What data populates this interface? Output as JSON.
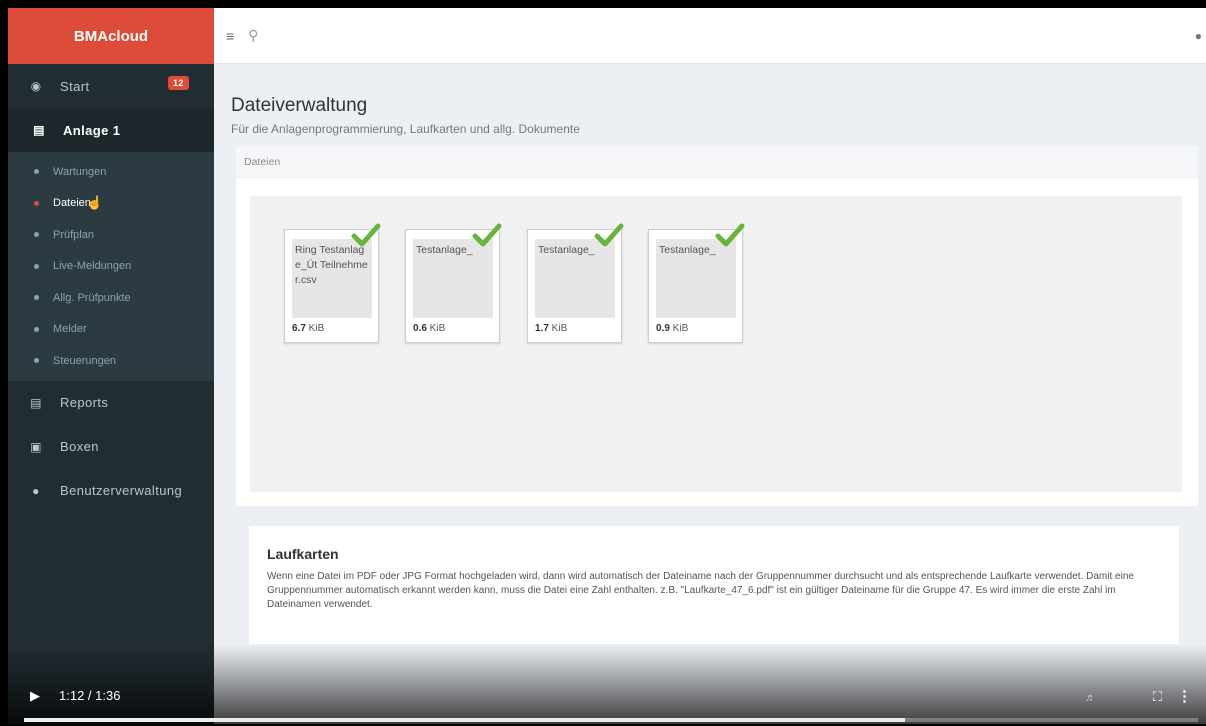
{
  "brand": "BMAcloud",
  "sidebar": {
    "start": {
      "label": "Start",
      "badge": "12"
    },
    "anlage": {
      "label": "Anlage 1"
    },
    "subitems": [
      {
        "label": "Wartungen"
      },
      {
        "label": "Dateien"
      },
      {
        "label": "Prüfplan"
      },
      {
        "label": "Live-Meldungen"
      },
      {
        "label": "Allg. Prüfpunkte"
      },
      {
        "label": "Melder"
      },
      {
        "label": "Steuerungen"
      }
    ],
    "reports": {
      "label": "Reports"
    },
    "boxen": {
      "label": "Boxen"
    },
    "benutzer": {
      "label": "Benutzerverwaltung"
    }
  },
  "page": {
    "title": "Dateiverwaltung",
    "subtitle": "Für die Anlagenprogrammierung, Laufkarten und allg. Dokumente"
  },
  "files_box": {
    "header": "Dateien",
    "files": [
      {
        "name": "Ring Testanlage_Üt Teilnehmer.csv",
        "size_value": "6.7",
        "size_unit": " KiB"
      },
      {
        "name": "Testanlage_",
        "size_value": "0.6",
        "size_unit": " KiB"
      },
      {
        "name": "Testanlage_",
        "size_value": "1.7",
        "size_unit": " KiB"
      },
      {
        "name": "Testanlage_",
        "size_value": "0.9",
        "size_unit": " KiB"
      }
    ]
  },
  "laufkarten": {
    "title": "Laufkarten",
    "text": "Wenn eine Datei im PDF oder JPG Format hochgeladen wird, dann wird automatisch der Dateiname nach der Gruppennummer durchsucht und als entsprechende Laufkarte verwendet. Damit eine Gruppennummer automatisch erkannt werden kann, muss die Datei eine Zahl enthalten. z.B. \"Laufkarte_47_6.pdf\" ist ein gültiger Dateiname für die Gruppe 47. Es wird immer die erste Zahl im Dateinamen verwendet."
  },
  "video": {
    "time": "1:12 / 1:36",
    "progress": 0.75
  },
  "colors": {
    "brand": "#dd4b39",
    "sidebar": "#222d32",
    "check": "#6ab43e"
  }
}
